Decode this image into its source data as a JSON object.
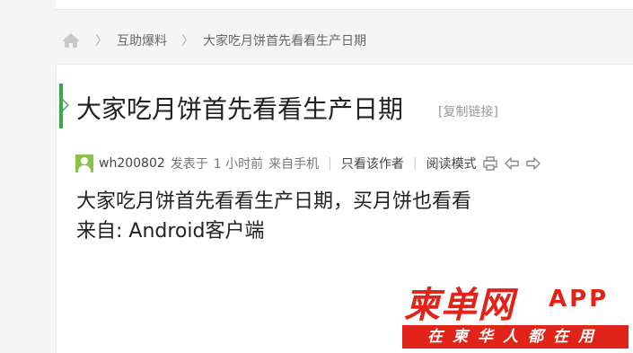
{
  "breadcrumb": {
    "items": [
      "互助爆料",
      "大家吃月饼首先看看生产日期"
    ],
    "separator": "〉"
  },
  "post": {
    "title": "大家吃月饼首先看看生产日期",
    "copy_link_label": "[复制链接]",
    "meta": {
      "author": "wh200802",
      "posted_label": "发表于",
      "time": "1 小时前",
      "source": "来自手机",
      "only_author_label": "只看该作者",
      "reading_mode_label": "阅读模式"
    },
    "body_lines": [
      "大家吃月饼首先看看生产日期，买月饼也看看",
      "来自: Android客户端"
    ]
  },
  "watermark": {
    "brand": "柬单网",
    "app": "APP",
    "slogan": "在柬华人都在用"
  },
  "colors": {
    "accent_green": "#3aa84d",
    "watermark_red": "#e2231a"
  }
}
